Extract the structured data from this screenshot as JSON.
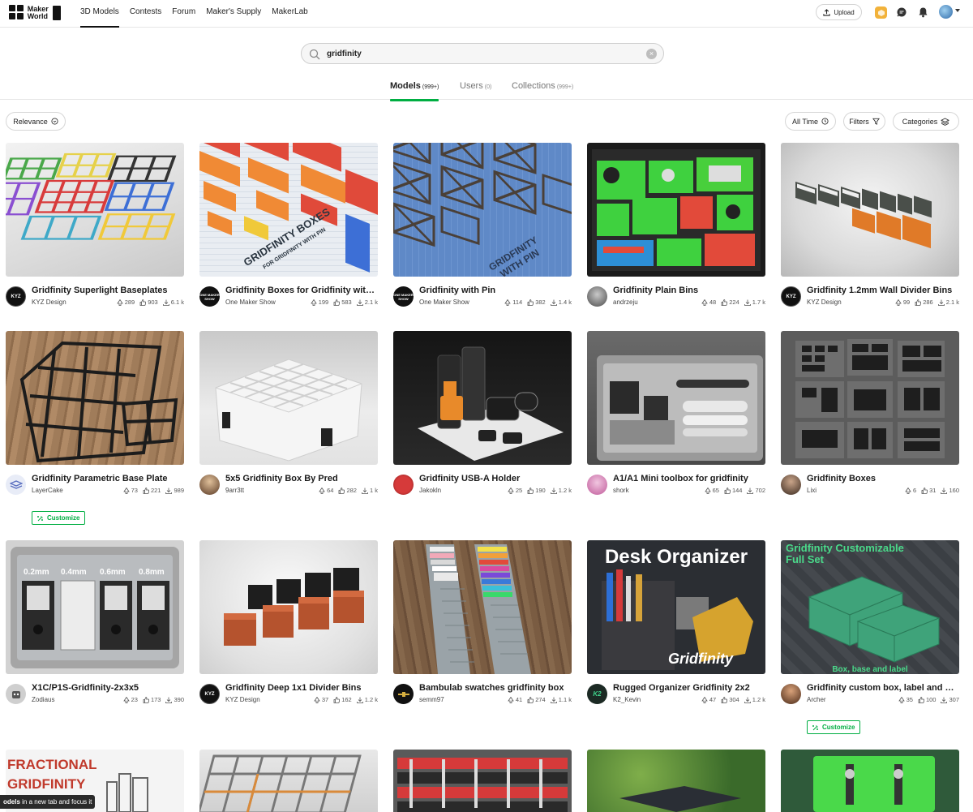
{
  "header": {
    "logo_text_line1": "Maker",
    "logo_text_line2": "World",
    "nav": [
      "3D Models",
      "Contests",
      "Forum",
      "Maker's Supply",
      "MakerLab"
    ],
    "upload_label": "Upload"
  },
  "search": {
    "value": "gridfinity"
  },
  "tabs": [
    {
      "label": "Models",
      "count": "(999+)"
    },
    {
      "label": "Users",
      "count": "(0)"
    },
    {
      "label": "Collections",
      "count": "(999+)"
    }
  ],
  "filters": {
    "sort_label": "Relevance",
    "time_label": "All Time",
    "filters_label": "Filters",
    "categories_label": "Categories"
  },
  "customize_label": "Customize",
  "cards": [
    {
      "title": "Gridfinity Superlight Baseplates",
      "author": "KYZ Design",
      "boosts": "289",
      "likes": "903",
      "downloads": "6.1 k",
      "customize": false,
      "avatar_text": "KYZ"
    },
    {
      "title": "Gridfinity Boxes for Gridfinity with Pin",
      "author": "One Maker Show",
      "boosts": "199",
      "likes": "583",
      "downloads": "2.1 k",
      "customize": false,
      "avatar_text": "ONE MAKER SHOW"
    },
    {
      "title": "Gridfinity with Pin",
      "author": "One Maker Show",
      "boosts": "114",
      "likes": "382",
      "downloads": "1.4 k",
      "customize": false,
      "avatar_text": "ONE MAKER SHOW"
    },
    {
      "title": "Gridfinity Plain Bins",
      "author": "andrzeju",
      "boosts": "48",
      "likes": "224",
      "downloads": "1.7 k",
      "customize": false,
      "avatar_text": ""
    },
    {
      "title": "Gridfinity 1.2mm Wall Divider Bins",
      "author": "KYZ Design",
      "boosts": "99",
      "likes": "286",
      "downloads": "2.1 k",
      "customize": false,
      "avatar_text": "KYZ"
    },
    {
      "title": "Gridfinity Parametric Base Plate",
      "author": "LayerCake",
      "boosts": "73",
      "likes": "221",
      "downloads": "989",
      "customize": true,
      "avatar_text": ""
    },
    {
      "title": "5x5 Gridfinity Box By Pred",
      "author": "9arr3tt",
      "boosts": "64",
      "likes": "282",
      "downloads": "1 k",
      "customize": false,
      "avatar_text": ""
    },
    {
      "title": "Gridfinity USB-A Holder",
      "author": "Jakokln",
      "boosts": "25",
      "likes": "190",
      "downloads": "1.2 k",
      "customize": false,
      "avatar_text": ""
    },
    {
      "title": "A1/A1 Mini toolbox for gridfinity",
      "author": "shork",
      "boosts": "65",
      "likes": "144",
      "downloads": "702",
      "customize": false,
      "avatar_text": ""
    },
    {
      "title": "Gridfinity Boxes",
      "author": "Lixi",
      "boosts": "6",
      "likes": "31",
      "downloads": "160",
      "customize": false,
      "avatar_text": ""
    },
    {
      "title": "X1C/P1S-Gridfinity-2x3x5",
      "author": "Zodiaus",
      "boosts": "23",
      "likes": "173",
      "downloads": "390",
      "customize": false,
      "avatar_text": ""
    },
    {
      "title": "Gridfinity Deep 1x1 Divider Bins",
      "author": "KYZ Design",
      "boosts": "37",
      "likes": "162",
      "downloads": "1.2 k",
      "customize": false,
      "avatar_text": "KYZ"
    },
    {
      "title": "Bambulab swatches gridfinity box",
      "author": "semm97",
      "boosts": "41",
      "likes": "274",
      "downloads": "1.1 k",
      "customize": false,
      "avatar_text": ""
    },
    {
      "title": "Rugged Organizer Gridfinity 2x2",
      "author": "K2_Kevin",
      "boosts": "47",
      "likes": "304",
      "downloads": "1.2 k",
      "customize": false,
      "avatar_text": "K2"
    },
    {
      "title": "Gridfinity custom box, label and base",
      "author": "Archer",
      "boosts": "35",
      "likes": "100",
      "downloads": "307",
      "customize": true,
      "avatar_text": ""
    }
  ],
  "thumb_text": {
    "c1": "GRIDFINITY BOXES",
    "c1b": "FOR GRIDFINITY WITH PIN",
    "c2": "GRIDFINITY",
    "c2b": "WITH PIN",
    "c10a": "0.2mm",
    "c10b": "0.4mm",
    "c10c": "0.6mm",
    "c10d": "0.8mm",
    "c13a": "Desk Organizer",
    "c13b": "Gridfinity",
    "c14a": "Gridfinity Customizable",
    "c14b": "Full Set",
    "c14c": "Box, base and label",
    "c15a": "FRACTIONAL",
    "c15b": "GRIDFINITY"
  },
  "tooltip": {
    "bold": "odels",
    "rest": " in a new tab and focus it"
  }
}
